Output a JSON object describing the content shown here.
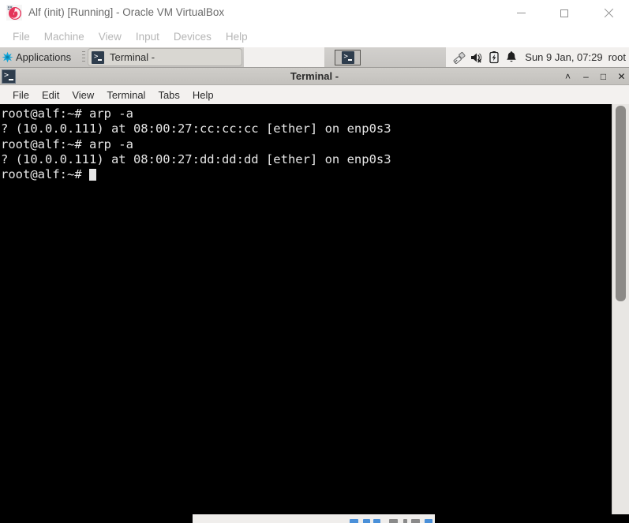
{
  "vbox": {
    "title": "Alf (init) [Running] - Oracle VM VirtualBox",
    "app_icon": "virtualbox-logo-icon",
    "menu": [
      {
        "label": "File",
        "name": "vbox-menu-file"
      },
      {
        "label": "Machine",
        "name": "vbox-menu-machine"
      },
      {
        "label": "View",
        "name": "vbox-menu-view"
      },
      {
        "label": "Input",
        "name": "vbox-menu-input"
      },
      {
        "label": "Devices",
        "name": "vbox-menu-devices"
      },
      {
        "label": "Help",
        "name": "vbox-menu-help"
      }
    ],
    "window_controls": {
      "minimize": "minimize-icon",
      "maximize": "maximize-icon",
      "close": "close-icon"
    }
  },
  "panel": {
    "applications_label": "Applications",
    "applications_icon": "xfce-mouse-star-icon",
    "handle_icon": "panel-drag-handle-icon",
    "tasks": [
      {
        "label": "Terminal -",
        "icon": "terminal-icon",
        "active": true
      }
    ],
    "pager_icon": "terminal-icon",
    "tray": [
      {
        "name": "usb-device-icon"
      },
      {
        "name": "volume-muted-icon"
      },
      {
        "name": "battery-icon"
      },
      {
        "name": "notification-bell-icon"
      }
    ],
    "clock": "Sun  9 Jan, 07:29",
    "user": "root"
  },
  "terminal": {
    "title": "Terminal -",
    "title_icon": "terminal-icon",
    "buttons": {
      "shade": "˄",
      "minimize": "–",
      "maximize": "□",
      "close": "✕"
    },
    "menu": [
      {
        "label": "File",
        "name": "term-menu-file"
      },
      {
        "label": "Edit",
        "name": "term-menu-edit"
      },
      {
        "label": "View",
        "name": "term-menu-view"
      },
      {
        "label": "Terminal",
        "name": "term-menu-terminal"
      },
      {
        "label": "Tabs",
        "name": "term-menu-tabs"
      },
      {
        "label": "Help",
        "name": "term-menu-help"
      }
    ],
    "lines": [
      "root@alf:~# arp -a",
      "? (10.0.0.111) at 08:00:27:cc:cc:cc [ether] on enp0s3",
      "root@alf:~# arp -a",
      "? (10.0.0.111) at 08:00:27:dd:dd:dd [ether] on enp0s3"
    ],
    "prompt": "root@alf:~# ",
    "colors": {
      "background": "#000000",
      "foreground": "#e6e6e6"
    }
  }
}
